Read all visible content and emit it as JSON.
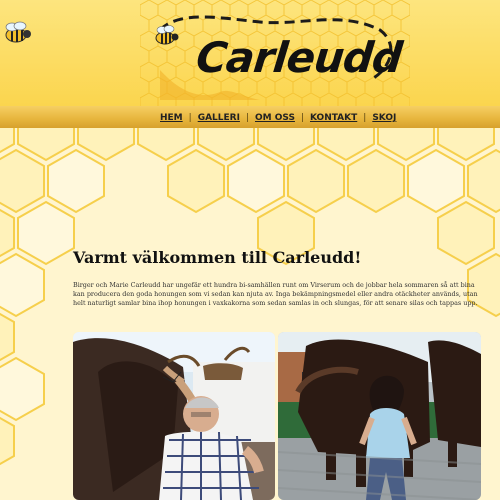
{
  "site": {
    "logo_text": "Carleudd"
  },
  "nav": {
    "items": [
      {
        "label": "HEM"
      },
      {
        "label": "GALLERI"
      },
      {
        "label": "OM OSS"
      },
      {
        "label": "KONTAKT"
      },
      {
        "label": "SKOJ"
      }
    ],
    "separator": "|"
  },
  "main": {
    "title": "Varmt välkommen till Carleudd!",
    "intro": "Birger och Marie Carleudd har ungefär ett hundra bi-samhällen runt om Virserum och de jobbar hela sommaren så att bina kan producera den goda honungen som vi sedan kan njuta av. Inga bekämpningsmedel eller andra otäckheter används, utan helt naturligt samlar bina ihop honungen i vaxkakorna som sedan samlas in och slungas, för att senare silas och tappas upp."
  },
  "colors": {
    "honey": "#fbd54e",
    "nav": "#e8b73f",
    "hex_fill": "#fff1b3",
    "hex_stroke": "#f4c832"
  },
  "icons": {
    "logo_bee": "bee-icon",
    "corner_bee": "bee-icon"
  }
}
